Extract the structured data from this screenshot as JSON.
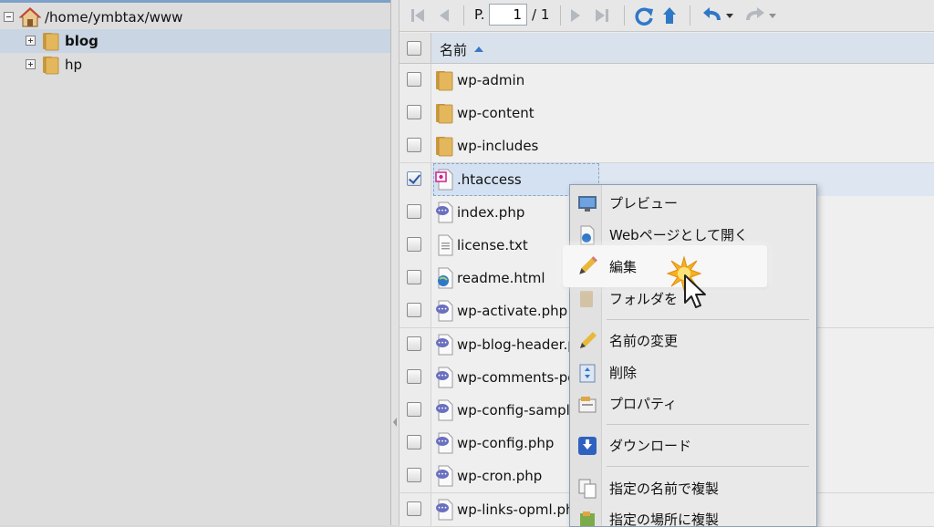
{
  "tree": {
    "root_path": "/home/ymbtax/www",
    "items": [
      {
        "label": "blog",
        "selected": true
      },
      {
        "label": "hp",
        "selected": false
      }
    ]
  },
  "toolbar": {
    "page_prefix": "P.",
    "page_current": "1",
    "page_total": "/ 1"
  },
  "list": {
    "column_name": "名前",
    "rows": [
      {
        "name": "wp-admin",
        "icon": "folder-icon",
        "checked": false
      },
      {
        "name": "wp-content",
        "icon": "folder-icon",
        "checked": false
      },
      {
        "name": "wp-includes",
        "icon": "folder-icon",
        "checked": false
      },
      {
        "name": ".htaccess",
        "icon": "htaccess-file-icon",
        "checked": true
      },
      {
        "name": "index.php",
        "icon": "php-file-icon",
        "checked": false
      },
      {
        "name": "license.txt",
        "icon": "text-file-icon",
        "checked": false
      },
      {
        "name": "readme.html",
        "icon": "html-file-icon",
        "checked": false
      },
      {
        "name": "wp-activate.php",
        "icon": "php-file-icon",
        "checked": false
      },
      {
        "name": "wp-blog-header.p",
        "icon": "php-file-icon",
        "checked": false
      },
      {
        "name": "wp-comments-po",
        "icon": "php-file-icon",
        "checked": false
      },
      {
        "name": "wp-config-sample",
        "icon": "php-file-icon",
        "checked": false
      },
      {
        "name": "wp-config.php",
        "icon": "php-file-icon",
        "checked": false
      },
      {
        "name": "wp-cron.php",
        "icon": "php-file-icon",
        "checked": false
      },
      {
        "name": "wp-links-opml.php",
        "icon": "php-file-icon",
        "checked": false
      }
    ]
  },
  "context_menu": {
    "items": [
      {
        "label": "プレビュー",
        "icon": "monitor-icon",
        "disabled": false
      },
      {
        "label": "Webページとして開く",
        "icon": "web-page-icon",
        "disabled": false
      },
      {
        "label": "編集",
        "icon": "pencil-icon",
        "disabled": false,
        "highlighted": true
      },
      {
        "label": "フォルダを",
        "icon": "folder-icon",
        "disabled": true
      },
      {
        "label": "名前の変更",
        "icon": "pencil-icon",
        "disabled": false
      },
      {
        "label": "削除",
        "icon": "delete-icon",
        "disabled": false
      },
      {
        "label": "プロパティ",
        "icon": "properties-icon",
        "disabled": false
      },
      {
        "label": "ダウンロード",
        "icon": "download-icon",
        "disabled": false
      },
      {
        "label": "指定の名前で複製",
        "icon": "copy-icon",
        "disabled": false
      },
      {
        "label": "指定の場所に複製",
        "icon": "copy-to-icon",
        "disabled": false
      }
    ]
  },
  "colors": {
    "selection": "#d4e1f2",
    "accent_blue": "#3b77c7",
    "folder": "#d9a84a"
  }
}
